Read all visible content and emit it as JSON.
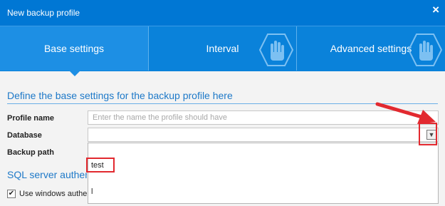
{
  "window": {
    "title": "New backup profile",
    "close_glyph": "×"
  },
  "tabs": [
    {
      "label": "Base settings",
      "active": true
    },
    {
      "label": "Interval",
      "active": false,
      "icon": "hand-icon"
    },
    {
      "label": "Advanced settings",
      "active": false,
      "icon": "hand-icon"
    }
  ],
  "base": {
    "heading": "Define the base settings for the backup profile here",
    "profile_name_label": "Profile name",
    "profile_name_placeholder": "Enter the name the profile should have",
    "database_label": "Database",
    "database_value": "",
    "backup_path_label": "Backup path",
    "dropdown_items": [
      "test",
      "l"
    ],
    "sql_heading": "SQL server authen",
    "windows_auth_label": "Use windows authe",
    "windows_auth_checked": true,
    "check_glyph": "✔"
  },
  "colors": {
    "titlebar": "#0077d4",
    "tabs": "#0a82da",
    "active_tab": "#1d8fe4",
    "heading": "#1e79c8",
    "highlight": "#e2292f"
  }
}
